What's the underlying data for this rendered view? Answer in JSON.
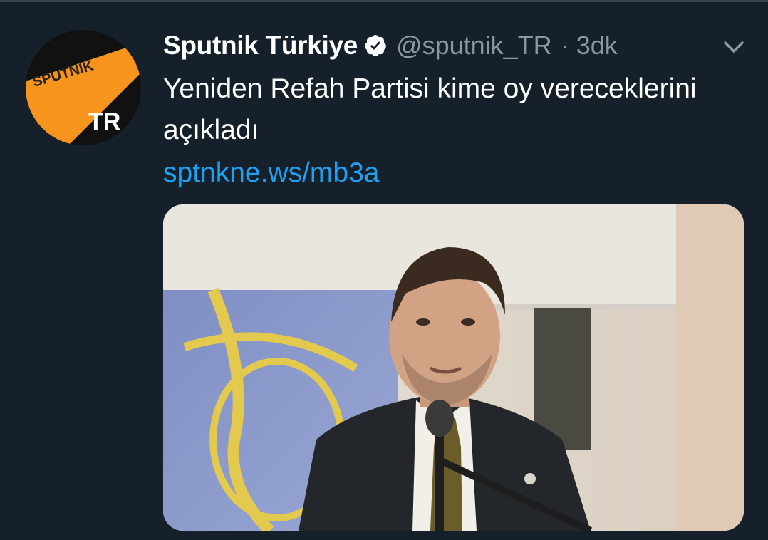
{
  "tweet": {
    "author": {
      "display_name": "Sputnik Türkiye",
      "handle": "@sputnik_TR",
      "verified": true,
      "avatar_logo_text": "SPUTNIK",
      "avatar_region_text": "TR"
    },
    "separator": "·",
    "time": "3dk",
    "text": "Yeniden Refah Partisi kime oy vereceklerini açıkladı",
    "link": "sptnkne.ws/mb3a",
    "menu_icon": "chevron-down-icon",
    "media_description_icon": "photo"
  },
  "colors": {
    "background": "#15202b",
    "text": "#ffffff",
    "secondary_text": "#8899a6",
    "link": "#1da1f2",
    "brand_orange": "#f7941d"
  }
}
